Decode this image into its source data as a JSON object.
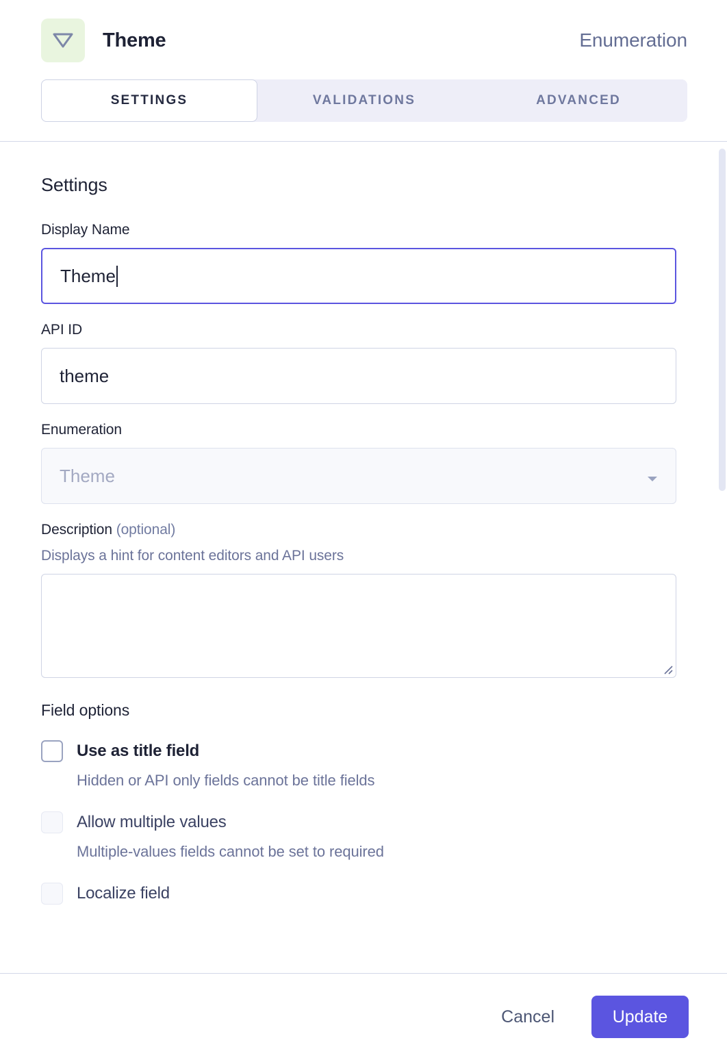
{
  "header": {
    "icon_name": "enumeration-triangle-icon",
    "icon_bg": "#e9f5df",
    "title": "Theme",
    "field_type": "Enumeration"
  },
  "tabs": [
    {
      "label": "SETTINGS",
      "active": true
    },
    {
      "label": "VALIDATIONS",
      "active": false
    },
    {
      "label": "ADVANCED",
      "active": false
    }
  ],
  "settings": {
    "section_title": "Settings",
    "display_name": {
      "label": "Display Name",
      "value": "Theme",
      "focused": true
    },
    "api_id": {
      "label": "API ID",
      "value": "theme"
    },
    "enumeration": {
      "label": "Enumeration",
      "value": "Theme",
      "disabled": true,
      "caret_icon": "chevron-down-icon"
    },
    "description": {
      "label": "Description",
      "label_optional": "(optional)",
      "hint": "Displays a hint for content editors and API users",
      "value": "",
      "placeholder": ""
    }
  },
  "field_options": {
    "title": "Field options",
    "items": [
      {
        "label": "Use as title field",
        "hint": "Hidden or API only fields cannot be title fields",
        "checked": false,
        "disabled": false
      },
      {
        "label": "Allow multiple values",
        "hint": "Multiple-values fields cannot be set to required",
        "checked": false,
        "disabled": true
      },
      {
        "label": "Localize field",
        "hint": "",
        "checked": false,
        "disabled": true
      }
    ]
  },
  "footer": {
    "cancel_label": "Cancel",
    "update_label": "Update",
    "primary_color": "#5b55e0"
  }
}
